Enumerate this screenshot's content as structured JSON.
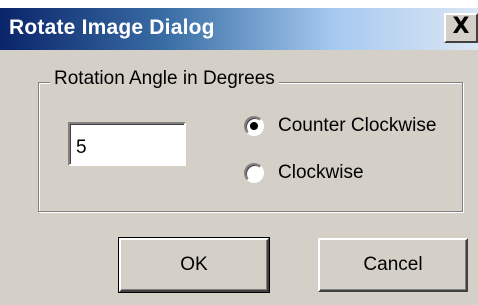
{
  "window": {
    "title": "Rotate Image Dialog",
    "close_glyph": "X"
  },
  "group": {
    "label": "Rotation Angle in Degrees"
  },
  "angle_input": {
    "value": "5"
  },
  "direction": {
    "options": [
      {
        "label": "Counter Clockwise",
        "selected": true
      },
      {
        "label": "Clockwise",
        "selected": false
      }
    ]
  },
  "buttons": {
    "ok_label": "OK",
    "cancel_label": "Cancel"
  },
  "colors": {
    "titlebar_start": "#0a246a",
    "titlebar_end": "#dbe6f3",
    "dialog_face": "#d4d0c8"
  }
}
